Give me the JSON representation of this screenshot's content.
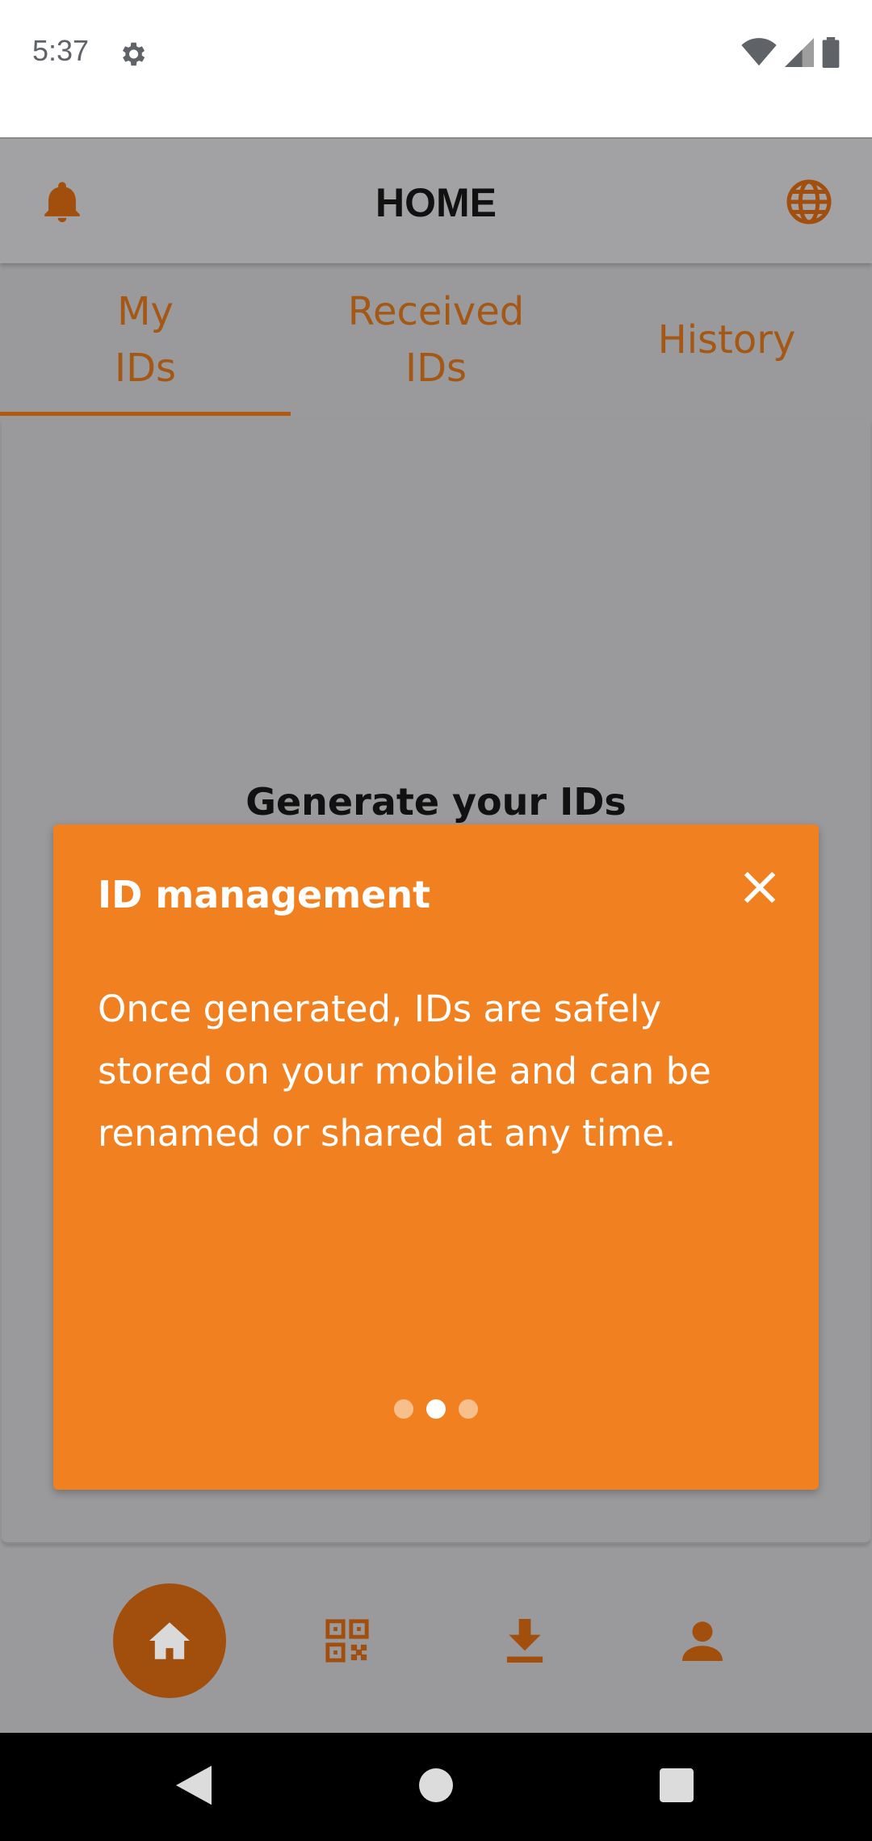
{
  "status_bar": {
    "time": "5:37"
  },
  "header": {
    "title": "HOME"
  },
  "tabs": [
    {
      "label": "My IDs"
    },
    {
      "label": "Received IDs"
    },
    {
      "label": "History"
    }
  ],
  "main": {
    "empty_heading": "Generate your IDs"
  },
  "tooltip": {
    "title": "ID management",
    "body": "Once generated, IDs are safely stored on your mobile and can be renamed or shared at any time.",
    "pages": 3,
    "current_page": 2
  },
  "bottom_nav": [
    {
      "icon": "home-icon",
      "selected": true
    },
    {
      "icon": "qr-code-icon",
      "selected": false
    },
    {
      "icon": "download-icon",
      "selected": false
    },
    {
      "icon": "person-icon",
      "selected": false
    }
  ],
  "colors": {
    "accent": "#f08020",
    "accent_dark": "#a24e0d",
    "scrim": "#9a999c"
  }
}
